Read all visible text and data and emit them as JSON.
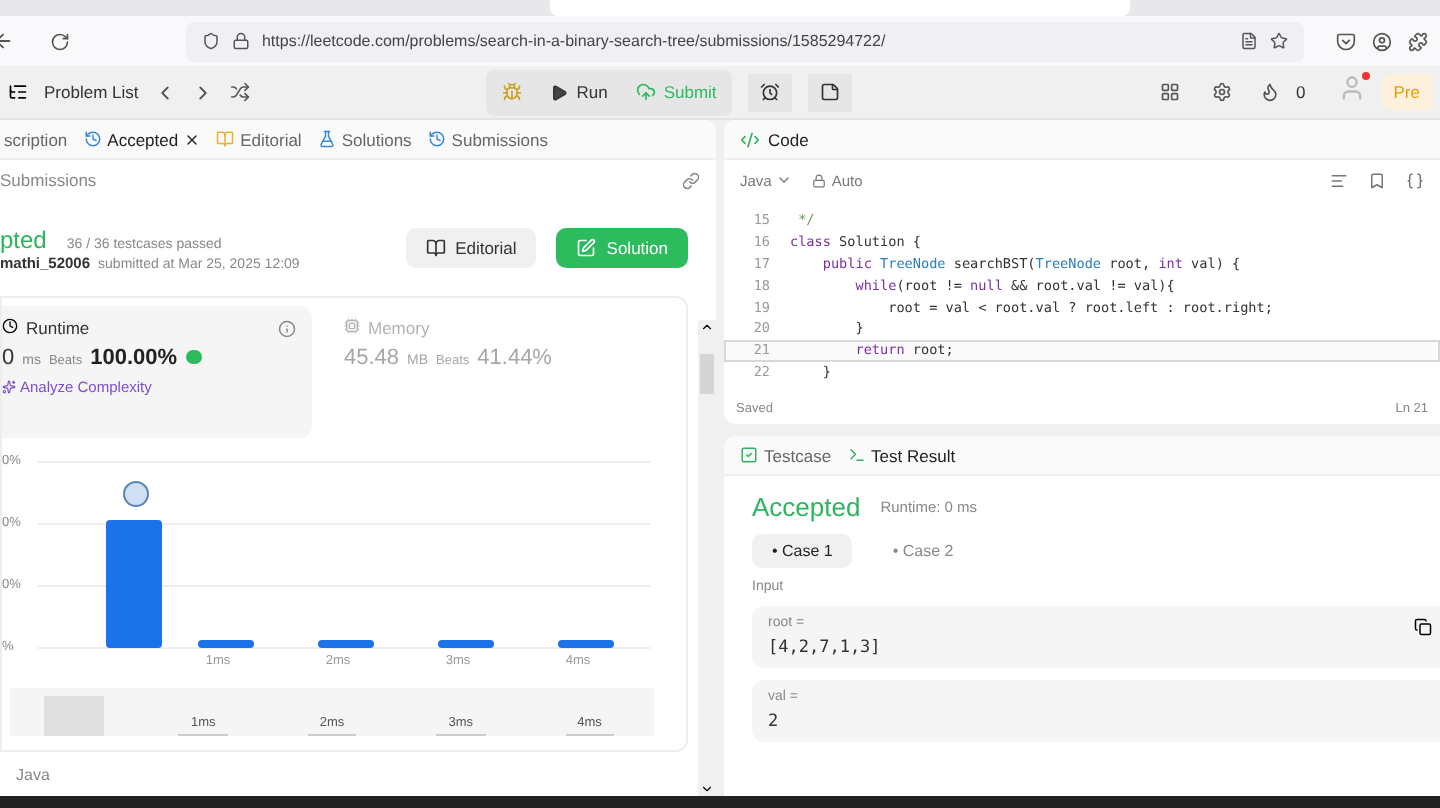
{
  "browser": {
    "url": "https://leetcode.com/problems/search-in-a-binary-search-tree/submissions/1585294722/"
  },
  "nav": {
    "problem_list": "Problem List",
    "run": "Run",
    "submit": "Submit",
    "streak": "0",
    "premium": "Pre",
    "has_notification": true
  },
  "left_tabs": [
    {
      "label": "scription",
      "closable": false,
      "selected": false
    },
    {
      "label": "Accepted",
      "closable": true,
      "selected": true
    },
    {
      "label": "Editorial",
      "closable": false,
      "selected": false
    },
    {
      "label": "Solutions",
      "closable": false,
      "selected": false
    },
    {
      "label": "Submissions",
      "closable": false,
      "selected": false
    }
  ],
  "back_link": "Submissions",
  "result": {
    "status": "pted",
    "passed": "36 / 36 testcases passed",
    "user": "mathi_52006",
    "submitted": "submitted at Mar 25, 2025 12:09",
    "editorial_button": "Editorial",
    "solution_button": "Solution"
  },
  "stats": [
    {
      "kind": "runtime",
      "title": "Runtime",
      "value": "0",
      "unit": "ms",
      "beats_label": "Beats",
      "beats": "100.00%",
      "link": "Analyze Complexity",
      "selected": true
    },
    {
      "kind": "memory",
      "title": "Memory",
      "value": "45.48",
      "unit": "MB",
      "beats_label": "Beats",
      "beats": "41.44%",
      "selected": false
    }
  ],
  "chart": {
    "y_labels": [
      "0%",
      "0%",
      "0%",
      "%"
    ],
    "x_labels": [
      "1ms",
      "2ms",
      "3ms",
      "4ms"
    ],
    "nav_labels": [
      "1ms",
      "2ms",
      "3ms",
      "4ms"
    ]
  },
  "language_footer": "Java",
  "code_panel": {
    "title": "Code",
    "language": "Java",
    "mode": "Auto",
    "status": "Saved",
    "cursor": "Ln 21",
    "lines": [
      {
        "number": "15",
        "current": false,
        "tokens": [
          {
            "kind": "comment",
            "text": " */"
          }
        ]
      },
      {
        "number": "16",
        "current": false,
        "tokens": [
          {
            "kind": "keyword",
            "text": "class"
          },
          {
            "kind": "plain",
            "text": " Solution {"
          }
        ]
      },
      {
        "number": "17",
        "current": false,
        "tokens": [
          {
            "kind": "keyword",
            "text": "    public"
          },
          {
            "kind": "type",
            "text": " TreeNode"
          },
          {
            "kind": "plain",
            "text": " searchBST("
          },
          {
            "kind": "type",
            "text": "TreeNode"
          },
          {
            "kind": "plain",
            "text": " root, "
          },
          {
            "kind": "keyword",
            "text": "int"
          },
          {
            "kind": "plain",
            "text": " val) {"
          }
        ]
      },
      {
        "number": "18",
        "current": false,
        "tokens": [
          {
            "kind": "keyword",
            "text": "        while"
          },
          {
            "kind": "plain",
            "text": "(root != "
          },
          {
            "kind": "keyword",
            "text": "null"
          },
          {
            "kind": "plain",
            "text": " && root.val != val){"
          }
        ]
      },
      {
        "number": "19",
        "current": false,
        "tokens": [
          {
            "kind": "plain",
            "text": "            root = val < root.val ? root.left : root.right;"
          }
        ]
      },
      {
        "number": "20",
        "current": false,
        "tokens": [
          {
            "kind": "plain",
            "text": "        }"
          }
        ]
      },
      {
        "number": "21",
        "current": true,
        "tokens": [
          {
            "kind": "keyword",
            "text": "        return"
          },
          {
            "kind": "plain",
            "text": " root;"
          }
        ]
      },
      {
        "number": "22",
        "current": false,
        "tokens": [
          {
            "kind": "plain",
            "text": "    }"
          }
        ]
      }
    ]
  },
  "test_tabs": [
    {
      "label": "Testcase",
      "selected": false
    },
    {
      "label": "Test Result",
      "selected": true
    }
  ],
  "test_result": {
    "status": "Accepted",
    "runtime": "Runtime: 0 ms",
    "cases": [
      {
        "label": "• Case 1",
        "selected": true
      },
      {
        "label": "• Case 2",
        "selected": false
      }
    ],
    "input_label": "Input",
    "inputs": [
      {
        "name": "root =",
        "value": "[4,2,7,1,3]"
      },
      {
        "name": "val =",
        "value": "2"
      }
    ]
  }
}
